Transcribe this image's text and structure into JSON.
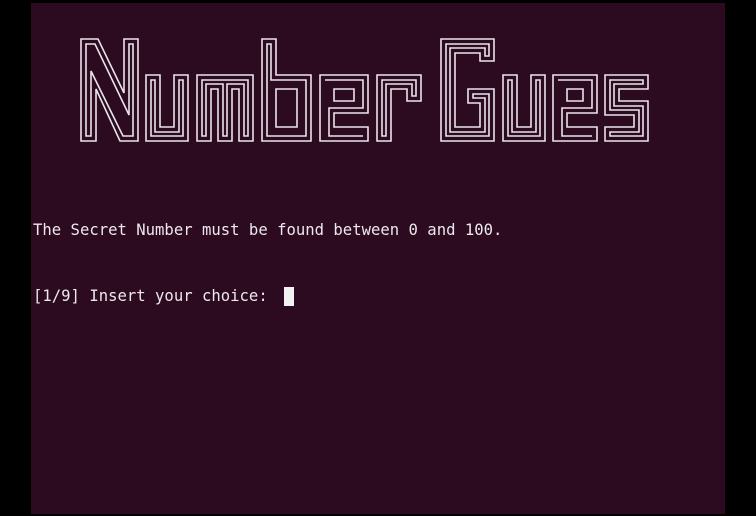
{
  "terminal": {
    "banner_text": "Number Guesser",
    "lines": [
      "The Secret Number must be found between 0 and 100.",
      "[1/9] Insert your choice: "
    ],
    "input_value": "",
    "colors": {
      "background": "#2c0b20",
      "foreground": "#ece8ec",
      "banner_stroke": "#e9e4ea",
      "cursor": "#f2f2f2",
      "scrollbar": "#c9c2c8"
    }
  }
}
